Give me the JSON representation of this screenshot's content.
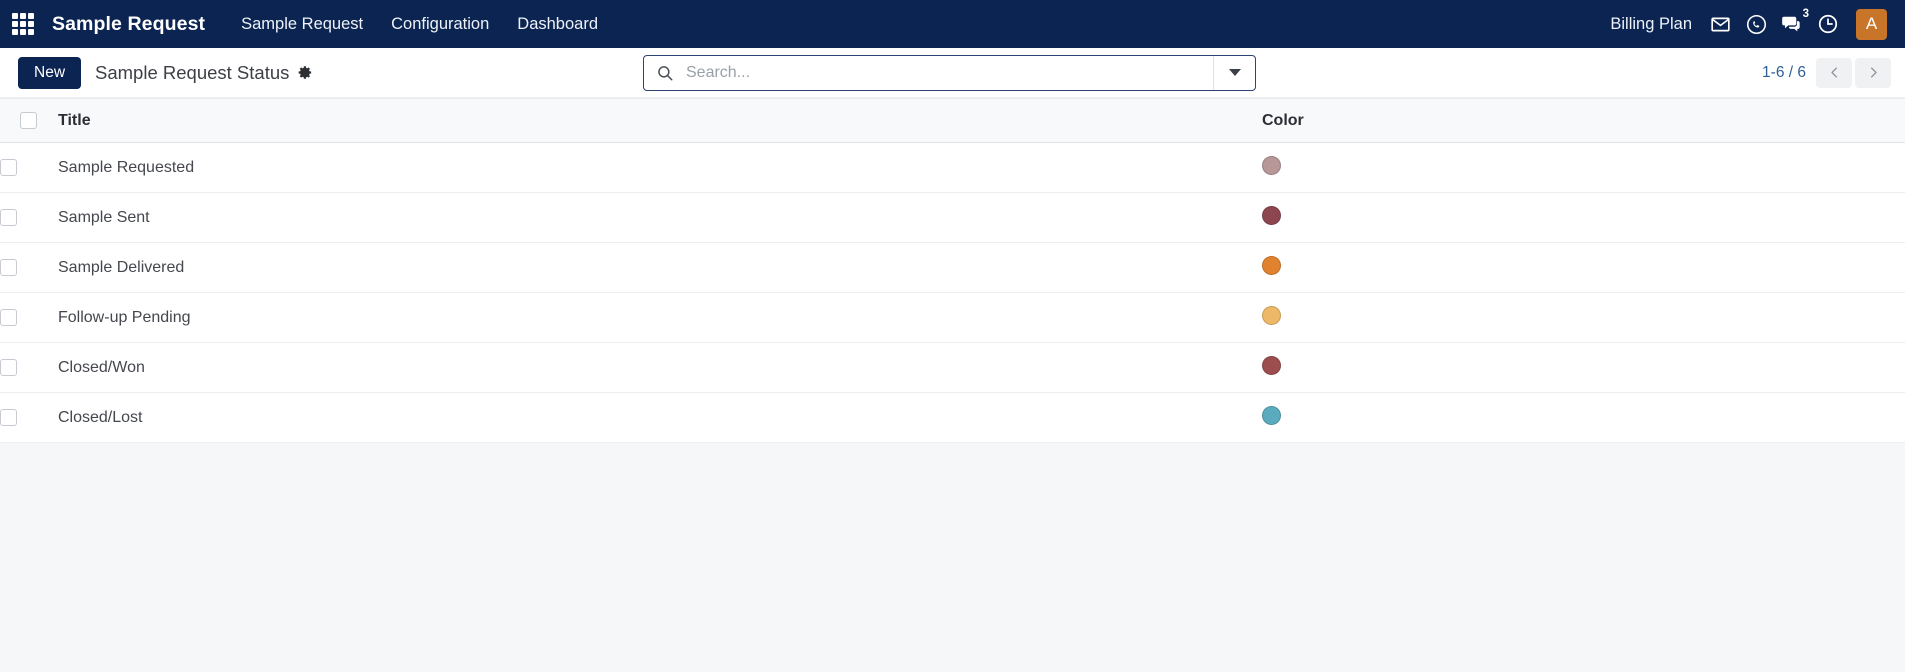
{
  "navbar": {
    "apps_icon": "apps-grid-icon",
    "brand": "Sample Request",
    "menu": [
      {
        "label": "Sample Request"
      },
      {
        "label": "Configuration"
      },
      {
        "label": "Dashboard"
      }
    ],
    "billing_label": "Billing Plan",
    "icons": [
      {
        "name": "mail-icon"
      },
      {
        "name": "whatsapp-icon"
      },
      {
        "name": "messages-icon",
        "badge": "3"
      },
      {
        "name": "activity-clock-icon"
      }
    ],
    "avatar_initial": "A",
    "colors": {
      "navbar_bg": "#0b2452",
      "avatar_bg": "#c8752a"
    }
  },
  "toolbar": {
    "new_label": "New",
    "title": "Sample Request Status",
    "gear_icon": "gear-icon",
    "search": {
      "icon": "search-icon",
      "placeholder": "Search...",
      "value": "",
      "toggle_icon": "chevron-down-icon"
    },
    "pager": {
      "count": "1-6 / 6",
      "prev_icon": "chevron-left-icon",
      "next_icon": "chevron-right-icon"
    }
  },
  "table": {
    "columns": [
      {
        "key": "title",
        "label": "Title"
      },
      {
        "key": "color",
        "label": "Color"
      }
    ],
    "rows": [
      {
        "title": "Sample Requested",
        "color": "#b79798"
      },
      {
        "title": "Sample Sent",
        "color": "#8d4650"
      },
      {
        "title": "Sample Delivered",
        "color": "#e1832e"
      },
      {
        "title": "Follow-up Pending",
        "color": "#edb968"
      },
      {
        "title": "Closed/Won",
        "color": "#9c4e4f"
      },
      {
        "title": "Closed/Lost",
        "color": "#5aabbd"
      }
    ]
  }
}
